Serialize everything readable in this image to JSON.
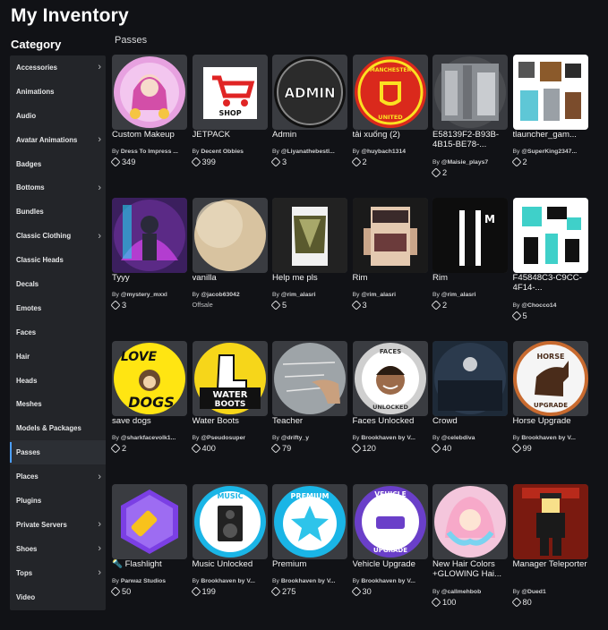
{
  "page_title": "My Inventory",
  "category_title": "Category",
  "section_title": "Passes",
  "sidebar": [
    {
      "label": "Accessories",
      "chevron": true
    },
    {
      "label": "Animations",
      "chevron": false
    },
    {
      "label": "Audio",
      "chevron": false
    },
    {
      "label": "Avatar Animations",
      "chevron": true
    },
    {
      "label": "Badges",
      "chevron": false
    },
    {
      "label": "Bottoms",
      "chevron": true
    },
    {
      "label": "Bundles",
      "chevron": false
    },
    {
      "label": "Classic Clothing",
      "chevron": true
    },
    {
      "label": "Classic Heads",
      "chevron": false
    },
    {
      "label": "Decals",
      "chevron": false
    },
    {
      "label": "Emotes",
      "chevron": false
    },
    {
      "label": "Faces",
      "chevron": false
    },
    {
      "label": "Hair",
      "chevron": false
    },
    {
      "label": "Heads",
      "chevron": false
    },
    {
      "label": "Meshes",
      "chevron": false
    },
    {
      "label": "Models & Packages",
      "chevron": false
    },
    {
      "label": "Passes",
      "chevron": false,
      "active": true
    },
    {
      "label": "Places",
      "chevron": true
    },
    {
      "label": "Plugins",
      "chevron": false
    },
    {
      "label": "Private Servers",
      "chevron": true
    },
    {
      "label": "Shoes",
      "chevron": true
    },
    {
      "label": "Tops",
      "chevron": true
    },
    {
      "label": "Video",
      "chevron": false
    }
  ],
  "items": [
    {
      "name": "Custom Makeup",
      "creator_prefix": "By ",
      "creator": "Dress To Impress ...",
      "price": "349",
      "icon": "makeup-thumbnail"
    },
    {
      "name": "JETPACK",
      "creator_prefix": "By ",
      "creator": "Decent Obbies",
      "price": "399",
      "icon": "shop-cart-thumbnail",
      "icon_text": "SHOP"
    },
    {
      "name": "Admin",
      "creator_prefix": "By ",
      "creator": "@Liyanathebestl...",
      "price": "3",
      "icon": "admin-thumbnail",
      "icon_text": "ADMIN"
    },
    {
      "name": "tải xuống (2)",
      "creator_prefix": "By ",
      "creator": "@huybach1314",
      "price": "2",
      "icon": "manchester-united-thumbnail",
      "icon_text": "MANCHESTER UNITED"
    },
    {
      "name": "E58139F2-B93B-4B15-BE78-...",
      "creator_prefix": "By ",
      "creator": "@Maisie_plays7",
      "price": "2",
      "icon": "photo-thumbnail"
    },
    {
      "name": "tlauncher_gam...",
      "creator_prefix": "By ",
      "creator": "@SuperKing2347...",
      "price": "2",
      "icon": "skin-thumbnail"
    },
    {
      "name": "Tyyy",
      "creator_prefix": "By ",
      "creator": "@mystery_mxxl",
      "price": "3",
      "icon": "neon-character-thumbnail"
    },
    {
      "name": "vanilla",
      "creator_prefix": "By ",
      "creator": "@jacob63042",
      "price": "",
      "offsale": "Offsale",
      "icon": "vanilla-thumbnail"
    },
    {
      "name": "Help me pls",
      "creator_prefix": "By ",
      "creator": "@rim_alasri",
      "price": "5",
      "icon": "clothing-thumbnail"
    },
    {
      "name": "Rim",
      "creator_prefix": "By ",
      "creator": "@rim_alasri",
      "price": "3",
      "icon": "clothing-thumbnail-2"
    },
    {
      "name": "Rim",
      "creator_prefix": "By ",
      "creator": "@rim_alasri",
      "price": "2",
      "icon": "suit-thumbnail",
      "icon_text": "M"
    },
    {
      "name": "F45848C3-C9CC-4F14-...",
      "creator_prefix": "By ",
      "creator": "@Chocco14",
      "price": "5",
      "icon": "pixel-skin-thumbnail"
    },
    {
      "name": "save dogs",
      "creator_prefix": "By ",
      "creator": "@sharkfacevolk1...",
      "price": "2",
      "icon": "love-dogs-thumbnail",
      "icon_text": "LOVE DOGS"
    },
    {
      "name": "Water Boots",
      "creator_prefix": "By ",
      "creator": "@Pseudosuper",
      "price": "400",
      "icon": "water-boots-thumbnail",
      "icon_text": "WATER BOOTS"
    },
    {
      "name": "Teacher",
      "creator_prefix": "By ",
      "creator": "@drifty_y",
      "price": "79",
      "icon": "chalkboard-thumbnail"
    },
    {
      "name": "Faces Unlocked",
      "creator_prefix": "By ",
      "creator": "Brookhaven by V...",
      "price": "120",
      "icon": "faces-unlocked-thumbnail",
      "icon_text": "FACES UNLOCKED"
    },
    {
      "name": "Crowd",
      "creator_prefix": "By ",
      "creator": "@celebdiva",
      "price": "40",
      "icon": "crowd-thumbnail"
    },
    {
      "name": "Horse Upgrade",
      "creator_prefix": "By ",
      "creator": "Brookhaven by V...",
      "price": "99",
      "icon": "horse-upgrade-thumbnail",
      "icon_text": "HORSE UPGRADE"
    },
    {
      "name": "🔦 Flashlight",
      "creator_prefix": "By ",
      "creator": "Parwaz Studios",
      "price": "50",
      "icon": "flashlight-thumbnail"
    },
    {
      "name": "Music Unlocked",
      "creator_prefix": "By ",
      "creator": "Brookhaven by V...",
      "price": "199",
      "icon": "music-unlocked-thumbnail",
      "icon_text": "MUSIC"
    },
    {
      "name": "Premium",
      "creator_prefix": "By ",
      "creator": "Brookhaven by V...",
      "price": "275",
      "icon": "premium-star-thumbnail",
      "icon_text": "PREMIUM"
    },
    {
      "name": "Vehicle Upgrade",
      "creator_prefix": "By ",
      "creator": "Brookhaven by V...",
      "price": "30",
      "icon": "vehicle-upgrade-thumbnail",
      "icon_text": "VEHICLE UPGRADE"
    },
    {
      "name": "New Hair Colors +GLOWING Hai...",
      "creator_prefix": "By ",
      "creator": "@callmehbob",
      "price": "100",
      "icon": "anime-hair-thumbnail"
    },
    {
      "name": "Manager Teleporter",
      "creator_prefix": "By ",
      "creator": "@Dued1",
      "price": "80",
      "icon": "manager-thumbnail"
    }
  ],
  "colors": {
    "background": "#111216",
    "sidebar": "#232529",
    "active_accent": "#4c9fff",
    "thumb_bg": "#3a3c41"
  }
}
